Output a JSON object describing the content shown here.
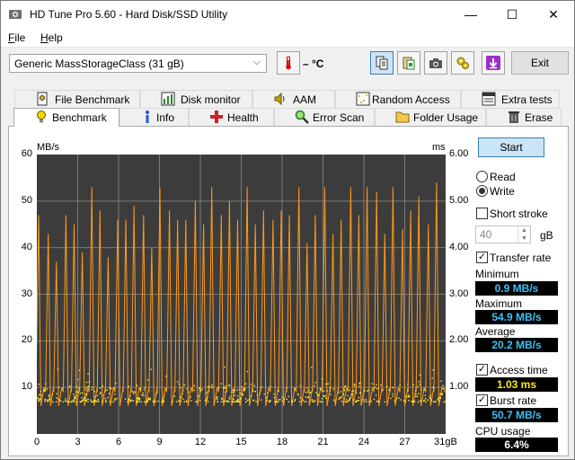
{
  "window": {
    "title": "HD Tune Pro 5.60 - Hard Disk/SSD Utility",
    "controls": {
      "minimize": "—",
      "maximize": "☐",
      "close": "✕"
    }
  },
  "menu": [
    {
      "key": "F",
      "rest": "ile"
    },
    {
      "key": "H",
      "rest": "elp"
    }
  ],
  "toolbar": {
    "drive": "Generic MassStorageClass (31 gB)",
    "temperature": "– °C",
    "exit_label": "Exit",
    "icons": [
      "copy-info-icon",
      "copy-clipboard-icon",
      "screenshot-camera-icon",
      "options-gear-icon",
      "save-download-icon"
    ]
  },
  "tabs_top": [
    {
      "label": "File Benchmark",
      "icon": "file-benchmark-icon"
    },
    {
      "label": "Disk monitor",
      "icon": "disk-monitor-icon"
    },
    {
      "label": "AAM",
      "icon": "speaker-icon"
    },
    {
      "label": "Random Access",
      "icon": "random-access-icon"
    },
    {
      "label": "Extra tests",
      "icon": "extra-tests-icon"
    }
  ],
  "tabs_bottom": [
    {
      "label": "Benchmark",
      "icon": "benchmark-bulb-icon",
      "selected": true
    },
    {
      "label": "Info",
      "icon": "info-icon"
    },
    {
      "label": "Health",
      "icon": "health-cross-icon"
    },
    {
      "label": "Error Scan",
      "icon": "magnifier-icon"
    },
    {
      "label": "Folder Usage",
      "icon": "folder-icon"
    },
    {
      "label": "Erase",
      "icon": "trash-icon"
    }
  ],
  "side": {
    "start_label": "Start",
    "read_label": "Read",
    "write_label": "Write",
    "mode": "write",
    "short_stroke_label": "Short stroke",
    "short_stroke_checked": false,
    "short_stroke_value": "40",
    "short_stroke_unit": "gB",
    "transfer_rate_label": "Transfer rate",
    "transfer_rate_checked": true,
    "minimum_label": "Minimum",
    "minimum_value": "0.9 MB/s",
    "maximum_label": "Maximum",
    "maximum_value": "54.9 MB/s",
    "average_label": "Average",
    "average_value": "20.2 MB/s",
    "access_time_label": "Access time",
    "access_time_checked": true,
    "access_time_value": "1.03 ms",
    "burst_rate_label": "Burst rate",
    "burst_rate_checked": true,
    "burst_rate_value": "50.7 MB/s",
    "cpu_usage_label": "CPU usage",
    "cpu_usage_value": "6.4%"
  },
  "colors": {
    "transfer_line": "#ff9a1a",
    "access_points": "#ffee33",
    "plot_bg": "#3c3c3c",
    "grid": "#7a7a7a",
    "stat_blue": "#3ec0f5",
    "stat_yellow": "#ffea00"
  },
  "chart_data": {
    "type": "line",
    "left_axis_unit": "MB/s",
    "right_axis_unit": "ms",
    "y_left_ticks": [
      "60",
      "50",
      "40",
      "30",
      "20",
      "10"
    ],
    "y_right_ticks": [
      "6.00",
      "5.00",
      "4.00",
      "3.00",
      "2.00",
      "1.00"
    ],
    "x_ticks": [
      "0",
      "3",
      "6",
      "9",
      "12",
      "15",
      "18",
      "21",
      "24",
      "27",
      "31gB"
    ],
    "ylim_left": [
      0,
      60
    ],
    "ylim_right": [
      0,
      6
    ],
    "xlim": [
      0,
      30
    ],
    "grid": true,
    "series": [
      {
        "kind": "transfer",
        "style": "spiky-sawtooth",
        "x": [
          0.2,
          0.9,
          1.5,
          2.2,
          2.8,
          3.4,
          4.1,
          4.7,
          5.3,
          6.0,
          6.6,
          7.2,
          7.9,
          8.5,
          9.1,
          9.8,
          10.4,
          11.0,
          11.7,
          12.3,
          12.9,
          13.6,
          14.2,
          14.8,
          15.5,
          16.1,
          16.7,
          17.4,
          18.0,
          18.6,
          19.3,
          19.9,
          20.5,
          21.2,
          21.8,
          22.4,
          23.1,
          23.7,
          24.3,
          25.0,
          25.6,
          26.2,
          26.9,
          27.5,
          28.1,
          28.8,
          29.4
        ],
        "peaks": [
          47,
          43,
          37,
          47,
          45,
          39,
          53,
          48,
          38,
          46,
          46,
          49,
          47,
          40,
          53,
          48,
          46,
          46,
          50,
          45,
          53,
          47,
          50,
          46,
          53,
          45,
          48,
          46,
          48,
          47,
          53,
          41,
          47,
          53,
          43,
          46,
          53,
          47,
          53,
          52,
          43,
          53,
          44,
          48,
          51,
          45,
          54
        ],
        "floor": 6
      },
      {
        "kind": "access_time",
        "style": "scatter",
        "typical_ms": 1.0,
        "spread_ms": [
          0.7,
          1.5
        ]
      }
    ]
  }
}
